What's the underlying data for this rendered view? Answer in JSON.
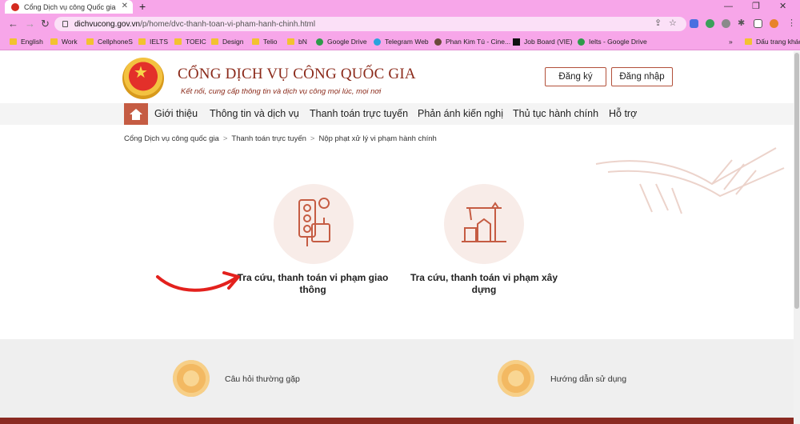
{
  "browser": {
    "tab_title": "Cổng Dịch vụ công Quốc gia",
    "url_host": "dichvucong.gov.vn",
    "url_path": "/p/home/dvc-thanh-toan-vi-pham-hanh-chinh.html",
    "bookmarks": [
      {
        "label": "English",
        "icon": "folder-icon"
      },
      {
        "label": "Work",
        "icon": "folder-icon"
      },
      {
        "label": "CellphoneS",
        "icon": "folder-icon"
      },
      {
        "label": "IELTS",
        "icon": "folder-icon"
      },
      {
        "label": "TOEIC",
        "icon": "folder-icon"
      },
      {
        "label": "Design",
        "icon": "folder-icon"
      },
      {
        "label": "Telio",
        "icon": "folder-icon"
      },
      {
        "label": "bN",
        "icon": "folder-icon"
      },
      {
        "label": "Google Drive",
        "icon": "google-drive-icon"
      },
      {
        "label": "Telegram Web",
        "icon": "telegram-icon"
      },
      {
        "label": "Phan Kim Tú - Cine...",
        "icon": "avatar-icon"
      },
      {
        "label": "Job Board (VIE)",
        "icon": "black-square-icon"
      },
      {
        "label": "Ielts - Google Drive",
        "icon": "google-drive-icon"
      }
    ],
    "other_bookmarks": "Dấu trang khác",
    "more_bookmarks": "»"
  },
  "header": {
    "title": "CỔNG DỊCH VỤ CÔNG QUỐC GIA",
    "subtitle": "Kết nối, cung cấp thông tin và dịch vụ công mọi lúc, mọi nơi",
    "register_label": "Đăng ký",
    "login_label": "Đăng nhập"
  },
  "nav": {
    "items": [
      "Giới thiệu",
      "Thông tin và dịch vụ",
      "Thanh toán trực tuyến",
      "Phản ánh kiến nghị",
      "Thủ tục hành chính",
      "Hỗ trợ"
    ]
  },
  "breadcrumb": [
    "Cổng Dịch vụ công quốc gia",
    "Thanh toán trực tuyến",
    "Nộp phạt xử lý vi phạm hành chính"
  ],
  "breadcrumb_sep": ">",
  "services": [
    {
      "label": "Tra cứu, thanh toán vi phạm giao thông",
      "icon": "traffic-light-icon"
    },
    {
      "label": "Tra cứu, thanh toán vi phạm xây dựng",
      "icon": "construction-crane-icon"
    }
  ],
  "footer": {
    "faq_label": "Câu hỏi thường gặp",
    "guide_label": "Hướng dẫn sử dụng"
  },
  "colors": {
    "chrome": "#f7a6e9",
    "brand": "#8b2a1a",
    "accent": "#c55c43",
    "arrow": "#e3211d"
  }
}
